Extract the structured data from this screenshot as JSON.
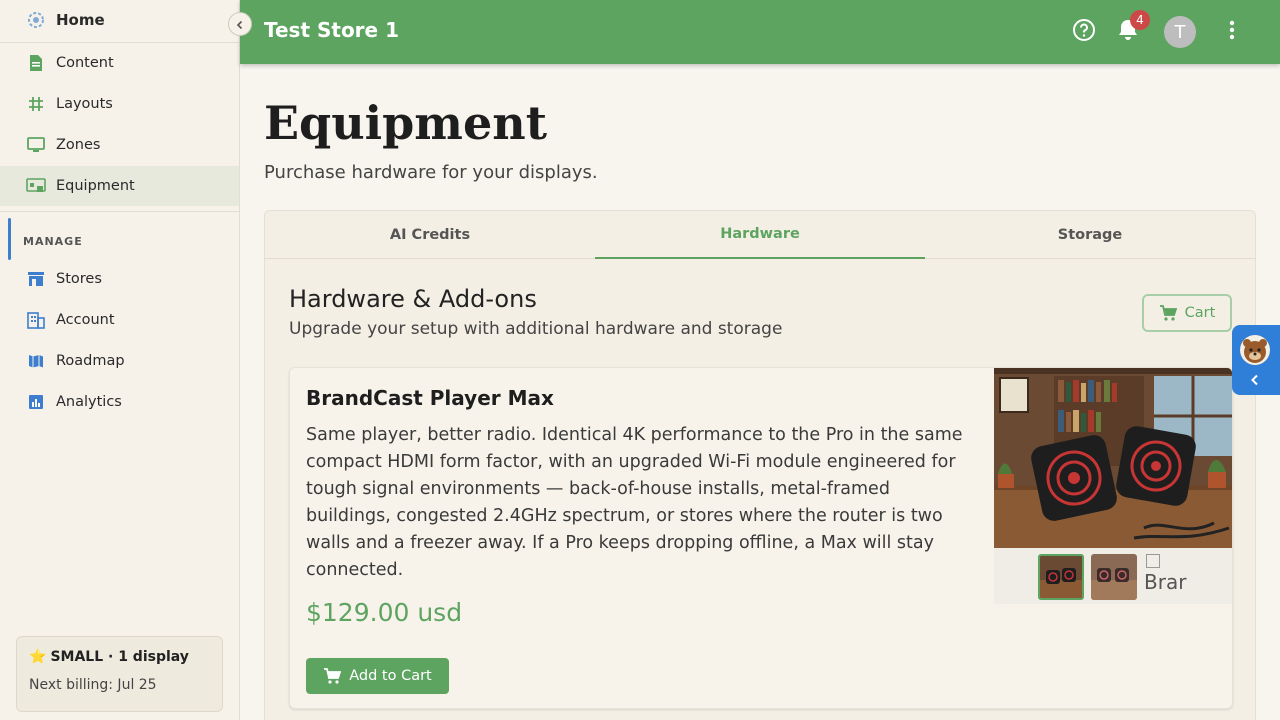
{
  "sidebar": {
    "items": [
      {
        "label": "Home",
        "icon": "gear-logo-icon"
      },
      {
        "label": "Content",
        "icon": "document-icon"
      },
      {
        "label": "Layouts",
        "icon": "hash-icon"
      },
      {
        "label": "Zones",
        "icon": "monitor-icon"
      },
      {
        "label": "Equipment",
        "icon": "equipment-icon"
      }
    ],
    "section_label": "MANAGE",
    "manage_items": [
      {
        "label": "Stores",
        "icon": "store-icon"
      },
      {
        "label": "Account",
        "icon": "building-icon"
      },
      {
        "label": "Roadmap",
        "icon": "map-icon"
      },
      {
        "label": "Analytics",
        "icon": "analytics-icon"
      }
    ],
    "plan": {
      "star": "⭐",
      "title": "SMALL · 1 display",
      "billing": "Next billing: Jul 25"
    }
  },
  "topbar": {
    "store_name": "Test Store 1",
    "notification_count": "4",
    "avatar_initial": "T"
  },
  "page": {
    "title": "Equipment",
    "subtitle": "Purchase hardware for your displays."
  },
  "tabs": [
    {
      "label": "AI Credits",
      "active": false
    },
    {
      "label": "Hardware",
      "active": true
    },
    {
      "label": "Storage",
      "active": false
    }
  ],
  "section": {
    "title": "Hardware & Add-ons",
    "subtitle": "Upgrade your setup with additional hardware and storage",
    "cart_label": "Cart"
  },
  "product": {
    "name": "BrandCast Player Max",
    "description": "Same player, better radio. Identical 4K performance to the Pro in the same compact HDMI form factor, with an upgraded Wi-Fi module engineered for tough signal environments — back-of-house installs, metal-framed buildings, congested 2.4GHz spectrum, or stores where the router is two walls and a freezer away. If a Pro keeps dropping offline, a Max will stay connected.",
    "price": "$129.00 usd",
    "add_label": "Add to Cart",
    "broken_thumb_alt": "Brar"
  },
  "colors": {
    "primary": "#5ea461",
    "assistant": "#2f7ed8",
    "badge": "#cf4848"
  }
}
